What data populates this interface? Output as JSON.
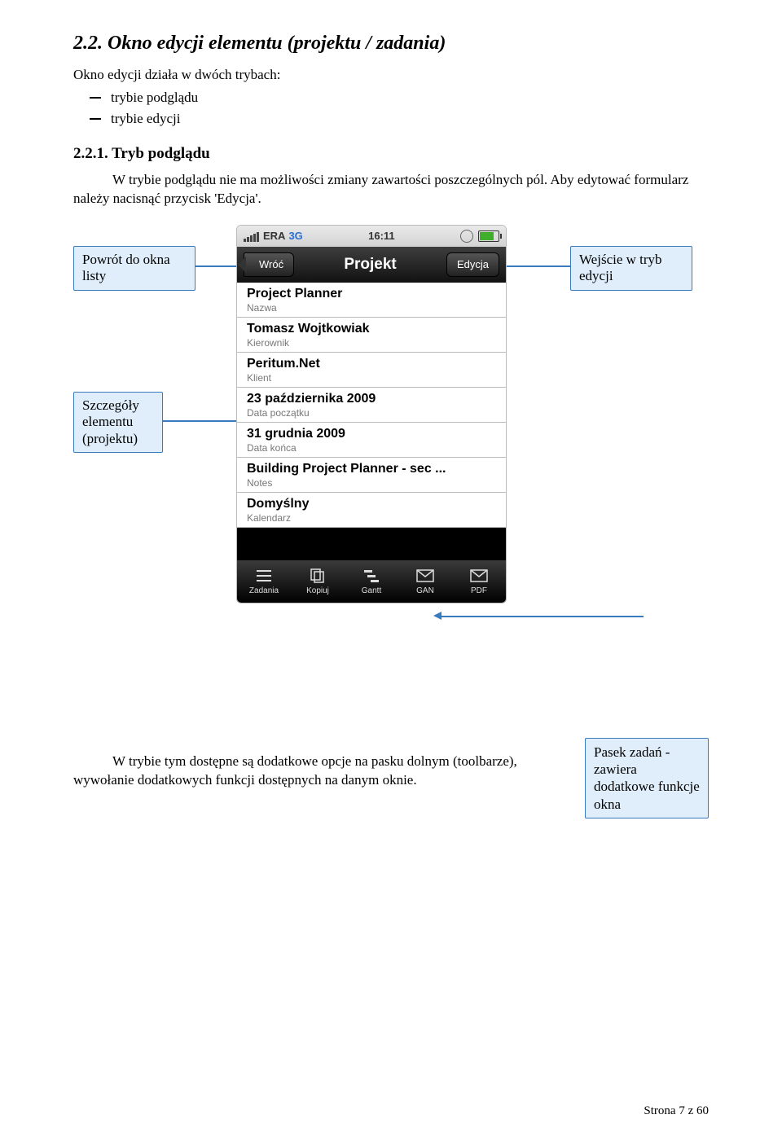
{
  "section": {
    "number": "2.2.",
    "title": "Okno edycji elementu (projektu / zadania)",
    "intro": "Okno edycji działa w dwóch trybach:",
    "bullets": [
      "trybie podglądu",
      "trybie edycji"
    ]
  },
  "subsection": {
    "number": "2.2.1.",
    "title": "Tryb podglądu",
    "para": "W trybie podglądu nie ma możliwości zmiany zawartości poszczególnych pól. Aby edytować formularz należy nacisnąć przycisk 'Edycja'."
  },
  "callouts": {
    "back": "Powrót do okna listy",
    "edit": "Wejście w tryb edycji",
    "details": "Szczegóły elementu (projektu)",
    "toolbar": "Pasek zadań - zawiera dodatkowe funkcje okna"
  },
  "phone": {
    "carrier": "ERA",
    "network": "3G",
    "time": "16:11",
    "nav": {
      "back": "Wróć",
      "title": "Projekt",
      "edit": "Edycja"
    },
    "rows": [
      {
        "value": "Project Planner",
        "label": "Nazwa"
      },
      {
        "value": "Tomasz Wojtkowiak",
        "label": "Kierownik"
      },
      {
        "value": "Peritum.Net",
        "label": "Klient"
      },
      {
        "value": "23 października 2009",
        "label": "Data początku"
      },
      {
        "value": "31 grudnia 2009",
        "label": "Data końca"
      },
      {
        "value": "Building Project Planner - sec ...",
        "label": "Notes"
      },
      {
        "value": "Domyślny",
        "label": "Kalendarz"
      }
    ],
    "tools": [
      "Zadania",
      "Kopiuj",
      "Gantt",
      "GAN",
      "PDF"
    ]
  },
  "bottom_para": "W trybie tym dostępne są dodatkowe opcje na pasku dolnym (toolbarze), wywołanie dodatkowych funkcji dostępnych na danym oknie.",
  "footer": "Strona 7 z 60"
}
